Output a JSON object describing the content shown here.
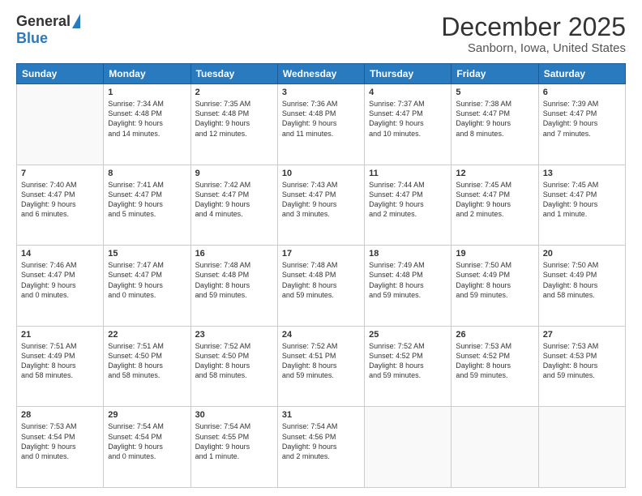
{
  "logo": {
    "general": "General",
    "blue": "Blue"
  },
  "title": "December 2025",
  "subtitle": "Sanborn, Iowa, United States",
  "days_of_week": [
    "Sunday",
    "Monday",
    "Tuesday",
    "Wednesday",
    "Thursday",
    "Friday",
    "Saturday"
  ],
  "weeks": [
    [
      {
        "num": "",
        "info": ""
      },
      {
        "num": "1",
        "info": "Sunrise: 7:34 AM\nSunset: 4:48 PM\nDaylight: 9 hours\nand 14 minutes."
      },
      {
        "num": "2",
        "info": "Sunrise: 7:35 AM\nSunset: 4:48 PM\nDaylight: 9 hours\nand 12 minutes."
      },
      {
        "num": "3",
        "info": "Sunrise: 7:36 AM\nSunset: 4:48 PM\nDaylight: 9 hours\nand 11 minutes."
      },
      {
        "num": "4",
        "info": "Sunrise: 7:37 AM\nSunset: 4:47 PM\nDaylight: 9 hours\nand 10 minutes."
      },
      {
        "num": "5",
        "info": "Sunrise: 7:38 AM\nSunset: 4:47 PM\nDaylight: 9 hours\nand 8 minutes."
      },
      {
        "num": "6",
        "info": "Sunrise: 7:39 AM\nSunset: 4:47 PM\nDaylight: 9 hours\nand 7 minutes."
      }
    ],
    [
      {
        "num": "7",
        "info": "Sunrise: 7:40 AM\nSunset: 4:47 PM\nDaylight: 9 hours\nand 6 minutes."
      },
      {
        "num": "8",
        "info": "Sunrise: 7:41 AM\nSunset: 4:47 PM\nDaylight: 9 hours\nand 5 minutes."
      },
      {
        "num": "9",
        "info": "Sunrise: 7:42 AM\nSunset: 4:47 PM\nDaylight: 9 hours\nand 4 minutes."
      },
      {
        "num": "10",
        "info": "Sunrise: 7:43 AM\nSunset: 4:47 PM\nDaylight: 9 hours\nand 3 minutes."
      },
      {
        "num": "11",
        "info": "Sunrise: 7:44 AM\nSunset: 4:47 PM\nDaylight: 9 hours\nand 2 minutes."
      },
      {
        "num": "12",
        "info": "Sunrise: 7:45 AM\nSunset: 4:47 PM\nDaylight: 9 hours\nand 2 minutes."
      },
      {
        "num": "13",
        "info": "Sunrise: 7:45 AM\nSunset: 4:47 PM\nDaylight: 9 hours\nand 1 minute."
      }
    ],
    [
      {
        "num": "14",
        "info": "Sunrise: 7:46 AM\nSunset: 4:47 PM\nDaylight: 9 hours\nand 0 minutes."
      },
      {
        "num": "15",
        "info": "Sunrise: 7:47 AM\nSunset: 4:47 PM\nDaylight: 9 hours\nand 0 minutes."
      },
      {
        "num": "16",
        "info": "Sunrise: 7:48 AM\nSunset: 4:48 PM\nDaylight: 8 hours\nand 59 minutes."
      },
      {
        "num": "17",
        "info": "Sunrise: 7:48 AM\nSunset: 4:48 PM\nDaylight: 8 hours\nand 59 minutes."
      },
      {
        "num": "18",
        "info": "Sunrise: 7:49 AM\nSunset: 4:48 PM\nDaylight: 8 hours\nand 59 minutes."
      },
      {
        "num": "19",
        "info": "Sunrise: 7:50 AM\nSunset: 4:49 PM\nDaylight: 8 hours\nand 59 minutes."
      },
      {
        "num": "20",
        "info": "Sunrise: 7:50 AM\nSunset: 4:49 PM\nDaylight: 8 hours\nand 58 minutes."
      }
    ],
    [
      {
        "num": "21",
        "info": "Sunrise: 7:51 AM\nSunset: 4:49 PM\nDaylight: 8 hours\nand 58 minutes."
      },
      {
        "num": "22",
        "info": "Sunrise: 7:51 AM\nSunset: 4:50 PM\nDaylight: 8 hours\nand 58 minutes."
      },
      {
        "num": "23",
        "info": "Sunrise: 7:52 AM\nSunset: 4:50 PM\nDaylight: 8 hours\nand 58 minutes."
      },
      {
        "num": "24",
        "info": "Sunrise: 7:52 AM\nSunset: 4:51 PM\nDaylight: 8 hours\nand 59 minutes."
      },
      {
        "num": "25",
        "info": "Sunrise: 7:52 AM\nSunset: 4:52 PM\nDaylight: 8 hours\nand 59 minutes."
      },
      {
        "num": "26",
        "info": "Sunrise: 7:53 AM\nSunset: 4:52 PM\nDaylight: 8 hours\nand 59 minutes."
      },
      {
        "num": "27",
        "info": "Sunrise: 7:53 AM\nSunset: 4:53 PM\nDaylight: 8 hours\nand 59 minutes."
      }
    ],
    [
      {
        "num": "28",
        "info": "Sunrise: 7:53 AM\nSunset: 4:54 PM\nDaylight: 9 hours\nand 0 minutes."
      },
      {
        "num": "29",
        "info": "Sunrise: 7:54 AM\nSunset: 4:54 PM\nDaylight: 9 hours\nand 0 minutes."
      },
      {
        "num": "30",
        "info": "Sunrise: 7:54 AM\nSunset: 4:55 PM\nDaylight: 9 hours\nand 1 minute."
      },
      {
        "num": "31",
        "info": "Sunrise: 7:54 AM\nSunset: 4:56 PM\nDaylight: 9 hours\nand 2 minutes."
      },
      {
        "num": "",
        "info": ""
      },
      {
        "num": "",
        "info": ""
      },
      {
        "num": "",
        "info": ""
      }
    ]
  ]
}
